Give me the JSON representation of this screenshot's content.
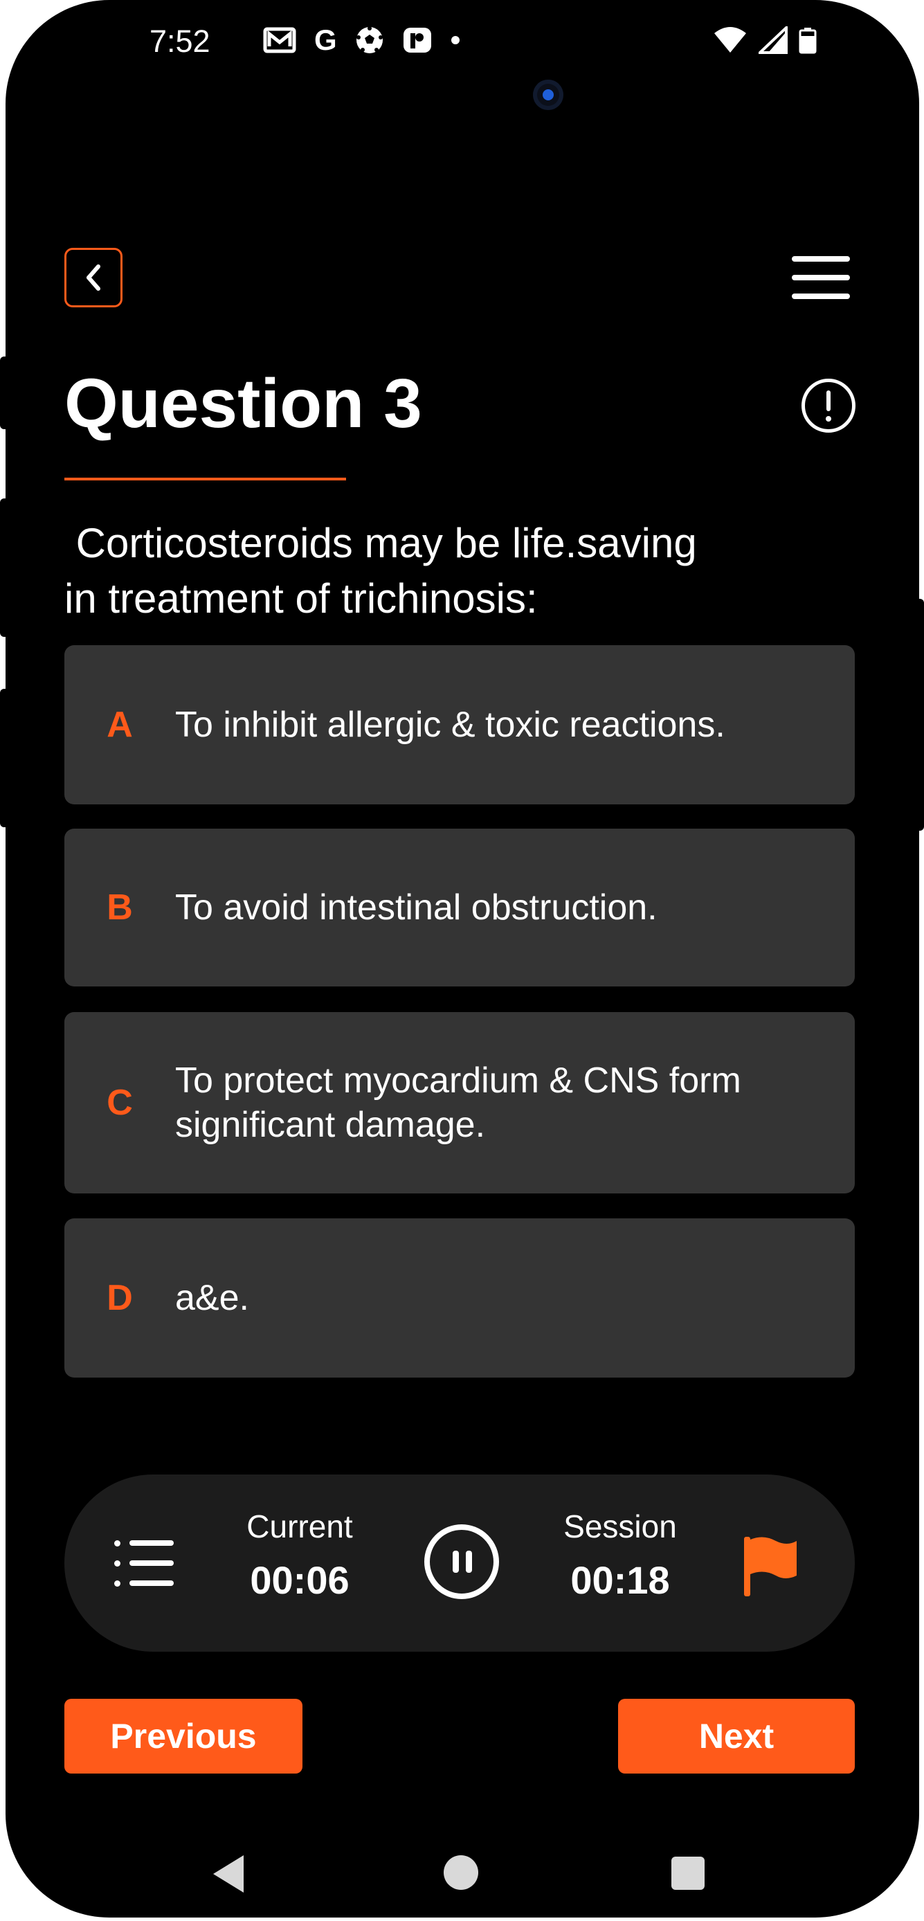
{
  "status_bar": {
    "time": "7:52",
    "icons": [
      "gmail-icon",
      "google-icon",
      "soccer-ball-icon",
      "app-icon",
      "dot-icon"
    ],
    "right_icons": [
      "wifi-icon",
      "signal-icon",
      "battery-icon"
    ]
  },
  "header": {
    "back_icon": "chevron-left-icon",
    "menu_icon": "hamburger-menu-icon"
  },
  "question": {
    "title": "Question 3",
    "info_icon": "exclamation-circle-icon",
    "text": " Corticosteroids may be life.saving\nin treatment of trichinosis:"
  },
  "options": [
    {
      "letter": "A",
      "text": "To inhibit allergic & toxic reactions."
    },
    {
      "letter": "B",
      "text": "To avoid intestinal obstruction."
    },
    {
      "letter": "C",
      "text": "To protect myocardium & CNS form significant damage."
    },
    {
      "letter": "D",
      "text": "a&e."
    }
  ],
  "timer": {
    "current_label": "Current",
    "current_value": "00:06",
    "session_label": "Session",
    "session_value": "00:18",
    "list_icon": "list-icon",
    "pause_icon": "pause-icon",
    "flag_icon": "flag-icon"
  },
  "nav": {
    "previous_label": "Previous",
    "next_label": "Next"
  },
  "colors": {
    "accent": "#ff5a1a",
    "background": "#000000",
    "option_bg": "#343434",
    "timer_bg": "#1c1c1c"
  }
}
